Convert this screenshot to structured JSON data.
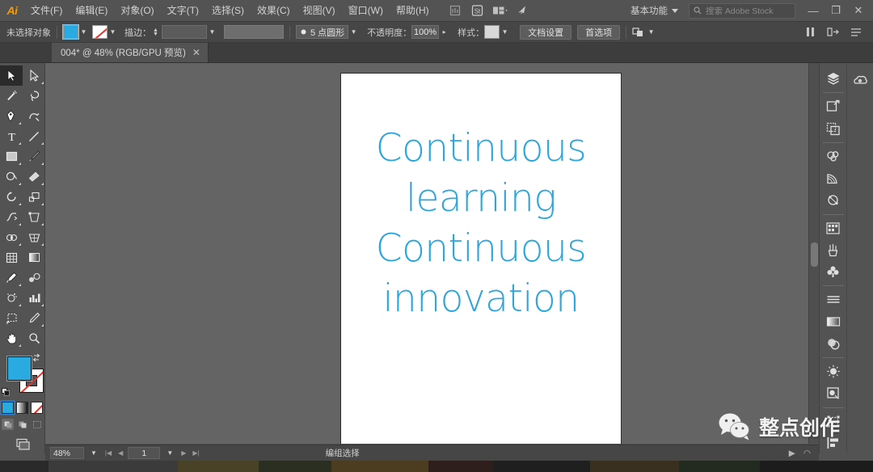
{
  "app": {
    "name": "Adobe Illustrator",
    "logo_text": "Ai"
  },
  "menubar": {
    "items": [
      {
        "label": "文件(F)",
        "name": "menu-file"
      },
      {
        "label": "编辑(E)",
        "name": "menu-edit"
      },
      {
        "label": "对象(O)",
        "name": "menu-object"
      },
      {
        "label": "文字(T)",
        "name": "menu-type"
      },
      {
        "label": "选择(S)",
        "name": "menu-select"
      },
      {
        "label": "效果(C)",
        "name": "menu-effect"
      },
      {
        "label": "视图(V)",
        "name": "menu-view"
      },
      {
        "label": "窗口(W)",
        "name": "menu-window"
      },
      {
        "label": "帮助(H)",
        "name": "menu-help"
      }
    ],
    "workspace": "基本功能",
    "search_placeholder": "搜索 Adobe Stock",
    "minimize": "—",
    "restore": "❐",
    "close": "✕"
  },
  "controlbar": {
    "selection_status": "未选择对象",
    "stroke_label": "描边：",
    "stroke_weight": "5 点圆形",
    "opacity_label": "不透明度：",
    "opacity_value": "100%",
    "style_label": "样式：",
    "doc_setup": "文档设置",
    "preferences": "首选项",
    "fill_color": "#29abe2",
    "stroke_color": "none"
  },
  "tab": {
    "title": "004* @ 48% (RGB/GPU 预览)",
    "close": "✕"
  },
  "toolbar": {
    "tools": [
      {
        "name": "selection-tool",
        "active": true,
        "corner": false
      },
      {
        "name": "direct-selection-tool",
        "active": false,
        "corner": true
      },
      {
        "name": "magic-wand-tool",
        "active": false,
        "corner": false
      },
      {
        "name": "lasso-tool",
        "active": false,
        "corner": false
      },
      {
        "name": "pen-tool",
        "active": false,
        "corner": true
      },
      {
        "name": "curvature-tool",
        "active": false,
        "corner": false
      },
      {
        "name": "type-tool",
        "active": false,
        "corner": true
      },
      {
        "name": "line-segment-tool",
        "active": false,
        "corner": true
      },
      {
        "name": "rectangle-tool",
        "active": false,
        "corner": true
      },
      {
        "name": "paintbrush-tool",
        "active": false,
        "corner": true
      },
      {
        "name": "shaper-tool",
        "active": false,
        "corner": true
      },
      {
        "name": "eraser-tool",
        "active": false,
        "corner": true
      },
      {
        "name": "rotate-tool",
        "active": false,
        "corner": true
      },
      {
        "name": "scale-tool",
        "active": false,
        "corner": true
      },
      {
        "name": "width-tool",
        "active": false,
        "corner": true
      },
      {
        "name": "free-transform-tool",
        "active": false,
        "corner": true
      },
      {
        "name": "shape-builder-tool",
        "active": false,
        "corner": true
      },
      {
        "name": "perspective-grid-tool",
        "active": false,
        "corner": true
      },
      {
        "name": "mesh-tool",
        "active": false,
        "corner": false
      },
      {
        "name": "gradient-tool",
        "active": false,
        "corner": false
      },
      {
        "name": "eyedropper-tool",
        "active": false,
        "corner": true
      },
      {
        "name": "blend-tool",
        "active": false,
        "corner": false
      },
      {
        "name": "symbol-sprayer-tool",
        "active": false,
        "corner": true
      },
      {
        "name": "column-graph-tool",
        "active": false,
        "corner": true
      },
      {
        "name": "artboard-tool",
        "active": false,
        "corner": false
      },
      {
        "name": "slice-tool",
        "active": false,
        "corner": true
      },
      {
        "name": "hand-tool",
        "active": false,
        "corner": true
      },
      {
        "name": "zoom-tool",
        "active": false,
        "corner": false
      }
    ],
    "fill_color": "#29abe2",
    "stroke_color": "#ffffff",
    "color_modes": [
      "color-mode",
      "gradient-mode",
      "none-mode"
    ],
    "draw_modes": [
      "draw-normal",
      "draw-behind",
      "draw-inside"
    ]
  },
  "dock": {
    "column_one": [
      {
        "name": "layers-panel-icon"
      },
      {
        "name": "artboards-panel-icon"
      },
      {
        "name": "asset-export-panel-icon"
      },
      {
        "name": "color-panel-icon"
      },
      {
        "name": "color-guide-panel-icon"
      },
      {
        "name": "color-themes-panel-icon"
      },
      {
        "name": "swatches-panel-icon"
      },
      {
        "name": "brushes-panel-icon"
      },
      {
        "name": "symbols-panel-icon"
      },
      {
        "name": "stroke-panel-icon"
      },
      {
        "name": "gradient-panel-icon"
      },
      {
        "name": "transparency-panel-icon"
      },
      {
        "name": "appearance-panel-icon"
      },
      {
        "name": "graphic-styles-panel-icon"
      },
      {
        "name": "transform-panel-icon"
      },
      {
        "name": "align-panel-icon"
      }
    ],
    "column_two": [
      {
        "name": "libraries-panel-icon"
      }
    ]
  },
  "canvas": {
    "artboard_background": "#ffffff",
    "art_text_color": "#2ca6dd",
    "art_lines": [
      "Continuous",
      "learning",
      "Continuous",
      "innovation"
    ]
  },
  "statusbar": {
    "zoom": "48%",
    "page": "1",
    "status_text": "编组选择",
    "prev_arrow": "◀",
    "next_arrow": "▶",
    "first_arrow": "|◀",
    "last_arrow": "▶|"
  },
  "watermark": {
    "text": "整点创作",
    "icon": "wechat-icon"
  }
}
